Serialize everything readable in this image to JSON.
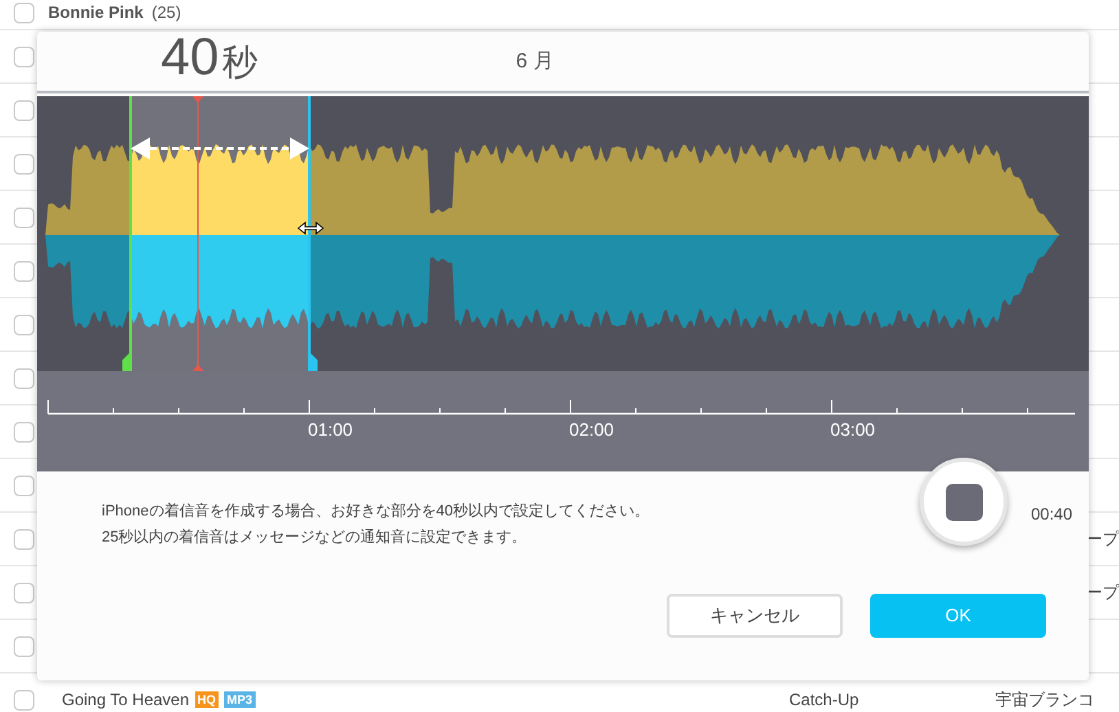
{
  "background_list": {
    "group_header": {
      "name": "Bonnie Pink",
      "count": "(25)",
      "checked": false
    },
    "rows": [
      {
        "checked": false
      },
      {
        "checked": false
      },
      {
        "checked": false
      },
      {
        "checked": false
      },
      {
        "checked": false
      },
      {
        "checked": false
      },
      {
        "checked": false
      },
      {
        "checked": false
      },
      {
        "checked": false
      },
      {
        "checked": false,
        "column_3": "ープ"
      },
      {
        "checked": false,
        "column_3": "ープ"
      },
      {
        "checked": false
      },
      {
        "checked": false,
        "title": "Going To Heaven",
        "badges": [
          {
            "label": "HQ",
            "color": "#f7941d"
          },
          {
            "label": "MP3",
            "color": "#5ab4e6"
          }
        ],
        "column_2": "Catch-Up",
        "column_3": "宇宙ブランコ"
      }
    ]
  },
  "dialog": {
    "duration": {
      "value": "40",
      "unit": "秒"
    },
    "track_title": "6 月",
    "timeline": {
      "labels": [
        "01:00",
        "02:00",
        "03:00"
      ]
    },
    "instructions": [
      "iPhoneの着信音を作成する場合、お好きな部分を40秒以内で設定してください。",
      "25秒以内の着信音はメッセージなどの通知音に設定できます。"
    ],
    "playback": {
      "playing": true,
      "time": "00:40"
    },
    "buttons": [
      {
        "label": "キャンセル",
        "kind": "secondary"
      },
      {
        "label": "OK",
        "kind": "primary"
      }
    ]
  }
}
